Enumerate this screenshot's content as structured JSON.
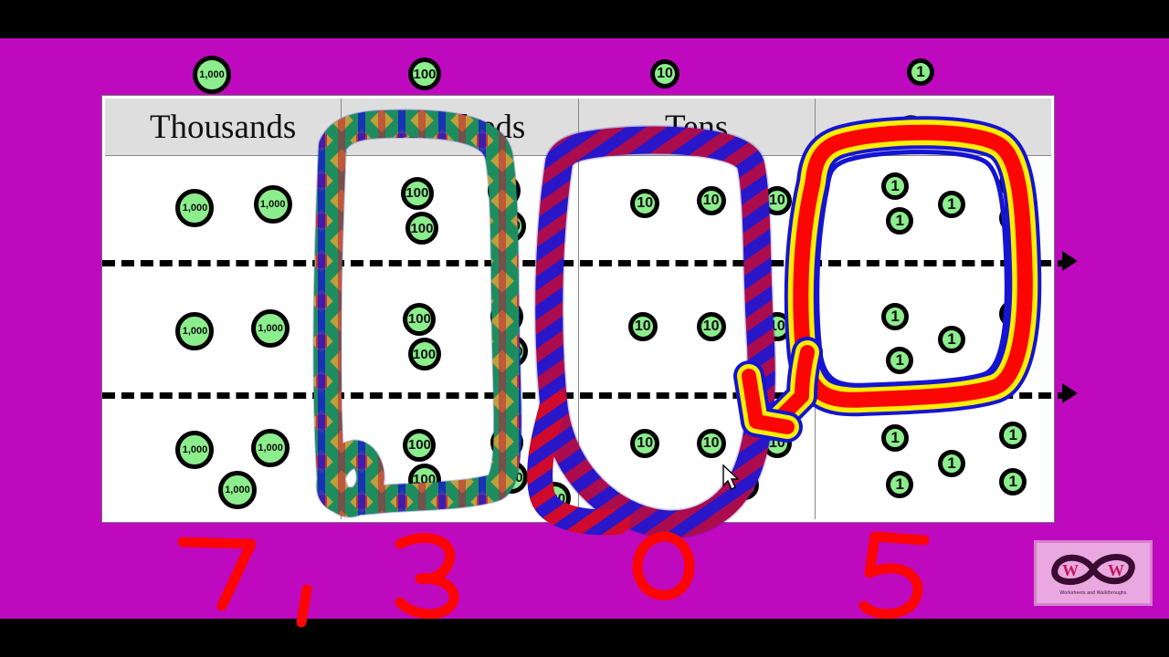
{
  "colors": {
    "slide_background": "#bf09bf",
    "letterbox": "#000000",
    "chip_fill": "#8ced8c",
    "chip_border": "#000000",
    "header_fill": "#dedede",
    "answer_red": "#fb0505",
    "hundreds_loop": "rainbow",
    "tens_loop": "#cf0a2c / #2a17c9 diagonal stripes",
    "ones_loop": "#fb0505 with #ffee00 and #1414d2 outline",
    "arrow": "#fb0505"
  },
  "legend": {
    "items": [
      {
        "label": "1,000",
        "name": "legend-chip-thousands"
      },
      {
        "label": "100",
        "name": "legend-chip-hundreds"
      },
      {
        "label": "10",
        "name": "legend-chip-tens"
      },
      {
        "label": "1",
        "name": "legend-chip-ones"
      }
    ]
  },
  "table": {
    "headers": [
      "Thousands",
      "Hundreds",
      "Tens",
      "Ones"
    ],
    "columns": [
      {
        "name": "thousands",
        "chip_label": "1,000",
        "rows": [
          {
            "count": 2,
            "positions": [
              [
                30,
                28
              ],
              [
                63,
                25
              ]
            ]
          },
          {
            "count": 2,
            "positions": [
              [
                30,
                28
              ],
              [
                62,
                26
              ]
            ]
          },
          {
            "count": 3,
            "positions": [
              [
                30,
                24
              ],
              [
                62,
                22
              ],
              [
                48,
                58
              ]
            ]
          }
        ]
      },
      {
        "name": "hundreds",
        "chip_label": "100",
        "rows": [
          {
            "count": 4,
            "positions": [
              [
                25,
                18
              ],
              [
                62,
                16
              ],
              [
                27,
                48
              ],
              [
                64,
                46
              ]
            ]
          },
          {
            "count": 4,
            "positions": [
              [
                26,
                20
              ],
              [
                63,
                18
              ],
              [
                28,
                50
              ],
              [
                65,
                48
              ]
            ]
          },
          {
            "count": 5,
            "positions": [
              [
                26,
                22
              ],
              [
                63,
                20
              ],
              [
                28,
                52
              ],
              [
                65,
                50
              ],
              [
                83,
                68
              ]
            ]
          }
        ]
      },
      {
        "name": "tens",
        "chip_label": "10",
        "rows": [
          {
            "count": 3,
            "positions": [
              [
                22,
                28
              ],
              [
                50,
                26
              ],
              [
                78,
                26
              ]
            ]
          },
          {
            "count": 3,
            "positions": [
              [
                21,
                28
              ],
              [
                50,
                28
              ],
              [
                78,
                28
              ]
            ]
          },
          {
            "count": 4,
            "positions": [
              [
                22,
                22
              ],
              [
                50,
                22
              ],
              [
                78,
                22
              ],
              [
                64,
                58
              ]
            ]
          }
        ]
      },
      {
        "name": "ones",
        "chip_label": "1",
        "rows": [
          {
            "count": 5,
            "positions": [
              [
                28,
                14
              ],
              [
                52,
                30
              ],
              [
                78,
                12
              ],
              [
                30,
                44
              ],
              [
                78,
                42
              ]
            ]
          },
          {
            "count": 5,
            "positions": [
              [
                28,
                20
              ],
              [
                52,
                40
              ],
              [
                78,
                18
              ],
              [
                30,
                58
              ],
              [
                78,
                56
              ]
            ]
          },
          {
            "count": 5,
            "positions": [
              [
                28,
                18
              ],
              [
                52,
                40
              ],
              [
                78,
                16
              ],
              [
                30,
                58
              ],
              [
                78,
                56
              ]
            ]
          }
        ]
      }
    ]
  },
  "answers": {
    "digits": [
      {
        "value": "7",
        "name": "answer-digit-thousands"
      },
      {
        "value": ",",
        "name": "answer-comma"
      },
      {
        "value": "3",
        "name": "answer-digit-hundreds"
      },
      {
        "value": "0",
        "name": "answer-digit-tens"
      },
      {
        "value": "5",
        "name": "answer-digit-ones"
      }
    ],
    "full_number": "7,305"
  },
  "logo": {
    "left_letter": "W",
    "right_letter": "W",
    "caption": "Worksheets and Walkthroughs"
  },
  "annotations": {
    "hundreds_circle": "rainbow-loop-around-hundreds",
    "tens_circle": "striped-loop-around-tens",
    "ones_circle": "red-loop-around-ones",
    "arrow": "red-arrow-pointing-down-left",
    "cursor": "mouse-pointer"
  }
}
